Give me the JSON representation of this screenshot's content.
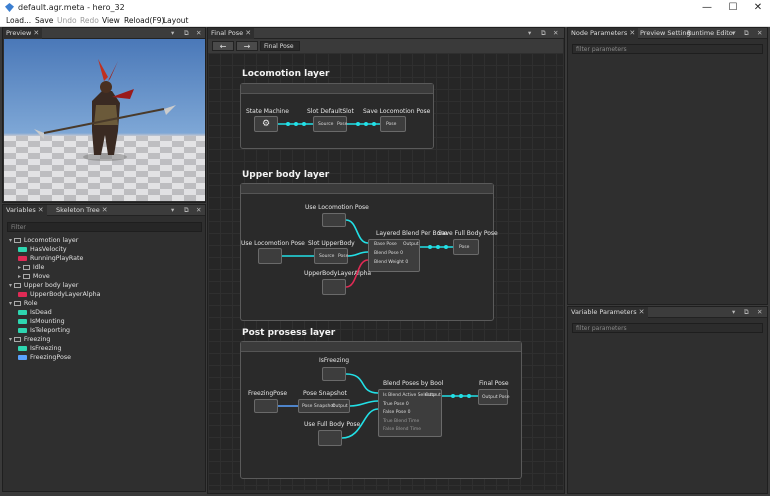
{
  "window": {
    "title": "default.agr.meta - hero_32",
    "minimize": "—",
    "maximize": "☐",
    "close": "✕"
  },
  "menu": {
    "items": [
      "Load...",
      "Save",
      "Undo",
      "Redo",
      "View",
      "Reload(F9)",
      "Layout"
    ]
  },
  "preview": {
    "tab": "Preview"
  },
  "variables": {
    "tabs": [
      "Variables",
      "Skeleton Tree"
    ],
    "filter_placeholder": "Filter",
    "tree": [
      {
        "label": "Locomotion layer",
        "type": "folder",
        "indent": 0
      },
      {
        "label": "HasVelocity",
        "type": "bool",
        "indent": 1
      },
      {
        "label": "RunningPlayRate",
        "type": "float",
        "indent": 1
      },
      {
        "label": "Idle",
        "type": "folder",
        "indent": 1
      },
      {
        "label": "Move",
        "type": "folder",
        "indent": 1
      },
      {
        "label": "Upper body layer",
        "type": "folder",
        "indent": 0
      },
      {
        "label": "UpperBodyLayerAlpha",
        "type": "float",
        "indent": 1
      },
      {
        "label": "Role",
        "type": "folder",
        "indent": 0
      },
      {
        "label": "IsDead",
        "type": "bool",
        "indent": 1
      },
      {
        "label": "IsMounting",
        "type": "bool",
        "indent": 1
      },
      {
        "label": "IsTeleporting",
        "type": "bool",
        "indent": 1
      },
      {
        "label": "Freezing",
        "type": "folder",
        "indent": 0
      },
      {
        "label": "IsFreezing",
        "type": "bool",
        "indent": 1
      },
      {
        "label": "FreezingPose",
        "type": "pose",
        "indent": 1
      }
    ],
    "colors": {
      "bool": "#2ed6b0",
      "float": "#e02a55",
      "pose": "#5aa2ff"
    }
  },
  "graph": {
    "tab": "Final Pose",
    "breadcrumb": "Final Pose",
    "back": "←",
    "forward": "→",
    "sections": {
      "locomotion": {
        "title": "Locomotion layer",
        "nodes": {
          "state_machine": "State Machine",
          "slot_default": "Slot DefaultSlot",
          "save_pose": "Save Locomotion Pose"
        },
        "pins": {
          "source": "Source",
          "pose": "Pose",
          "pose_in": "Pose"
        }
      },
      "upper": {
        "title": "Upper body layer",
        "nodes": {
          "use_loco_top": "Use Locomotion Pose",
          "use_loco_left": "Use Locomotion Pose",
          "slot_upper": "Slot UpperBody",
          "layered": "Layered Blend Per Bone",
          "save_full": "Save Full Body Pose",
          "alpha": "UpperBodyLayerAlpha"
        },
        "pins": {
          "source": "Source",
          "pose": "Pose",
          "base_pose": "Base Pose",
          "blend_pose": "Blend Pose 0",
          "blend_weight": "Blend Weight 0",
          "output": "Output",
          "pose_in": "Pose"
        }
      },
      "post": {
        "title": "Post prosess layer",
        "nodes": {
          "is_freezing": "IsFreezing",
          "freezing_pose": "FreezingPose",
          "snapshot": "Pose Snapshot",
          "use_full": "Use Full Body Pose",
          "blend_bool": "Blend Poses by Bool",
          "final": "Final Pose"
        },
        "pins": {
          "pose_snapshot": "Pose Snapshot",
          "output": "Output",
          "active_value": "Is Blend Active Selector",
          "true_pose": "True Pose 0",
          "false_pose": "False Pose 0",
          "true_time": "True Blend Time",
          "false_time": "False Blend Time",
          "result": "Output Pose"
        }
      }
    }
  },
  "right_top": {
    "tabs": [
      "Node Parameters",
      "Preview Setting",
      "Runtime Editor"
    ],
    "filter": "filter parameters"
  },
  "right_bottom": {
    "tab": "Variable Parameters",
    "filter": "filter parameters"
  }
}
